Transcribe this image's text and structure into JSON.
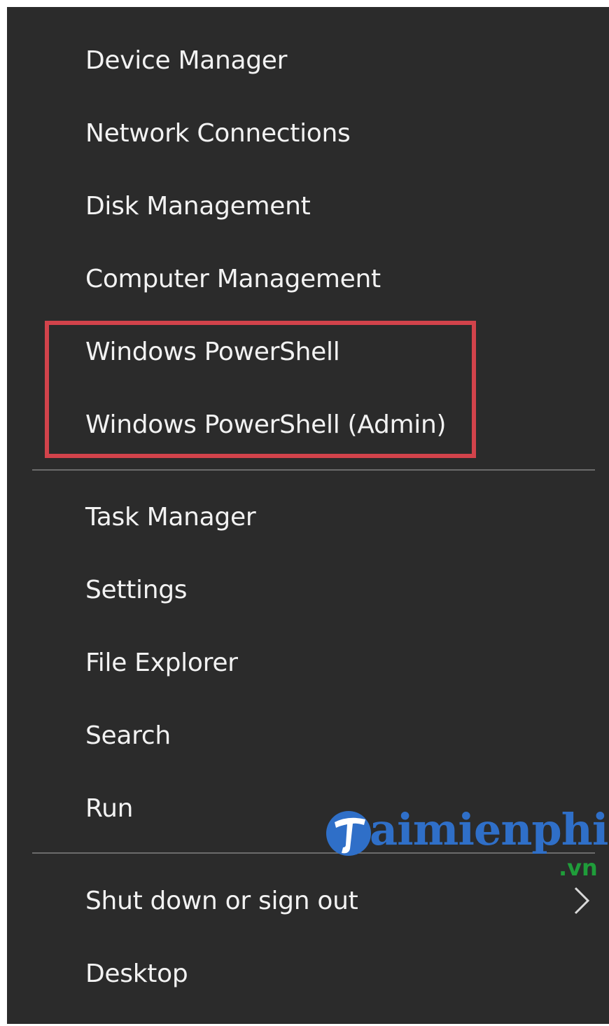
{
  "menu": {
    "items": [
      {
        "label": "Device Manager"
      },
      {
        "label": "Network Connections"
      },
      {
        "label": "Disk Management"
      },
      {
        "label": "Computer Management"
      },
      {
        "label": "Windows PowerShell"
      },
      {
        "label": "Windows PowerShell (Admin)"
      },
      {
        "label": "Task Manager"
      },
      {
        "label": "Settings"
      },
      {
        "label": "File Explorer"
      },
      {
        "label": "Search"
      },
      {
        "label": "Run"
      },
      {
        "label": "Shut down or sign out",
        "submenu_icon": "chevron-right-icon"
      },
      {
        "label": "Desktop"
      }
    ]
  },
  "highlight": {
    "color": "#d2434b"
  },
  "watermark": {
    "brand": "aimienphi",
    "domain": ".vn"
  },
  "colors": {
    "background": "#2b2b2b",
    "text": "#f2f2f2",
    "separator": "#6b6b6b"
  }
}
